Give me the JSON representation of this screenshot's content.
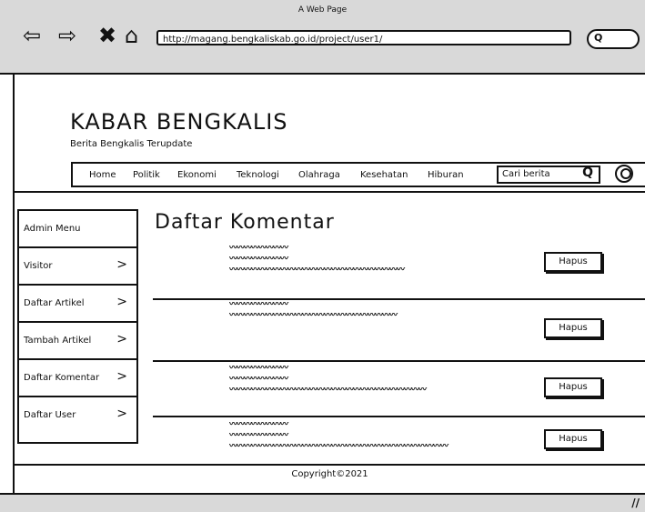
{
  "browser": {
    "title": "A Web Page",
    "url": "http://magang.bengkaliskab.go.id/project/user1/",
    "icons": [
      "back-arrow-icon",
      "forward-arrow-icon",
      "close-icon",
      "home-icon",
      "search-icon"
    ]
  },
  "site": {
    "title": "KABAR BENGKALIS",
    "tagline": "Berita Bengkalis Terupdate"
  },
  "menu": {
    "items": [
      "Home",
      "Politik",
      "Ekonomi",
      "Teknologi",
      "Olahraga",
      "Kesehatan",
      "Hiburan"
    ],
    "search_placeholder": "Cari berita"
  },
  "sidebar": {
    "items": [
      {
        "label": "Admin Menu",
        "chevron": ""
      },
      {
        "label": "Visitor",
        "chevron": ">"
      },
      {
        "label": "Daftar Artikel",
        "chevron": ">"
      },
      {
        "label": "Tambah Artikel",
        "chevron": ">"
      },
      {
        "label": "Daftar Komentar",
        "chevron": ">"
      },
      {
        "label": "Daftar User",
        "chevron": ">"
      }
    ]
  },
  "main": {
    "heading": "Daftar Komentar",
    "delete_label": "Hapus"
  },
  "footer": {
    "copyright": "Copyright©2021"
  }
}
